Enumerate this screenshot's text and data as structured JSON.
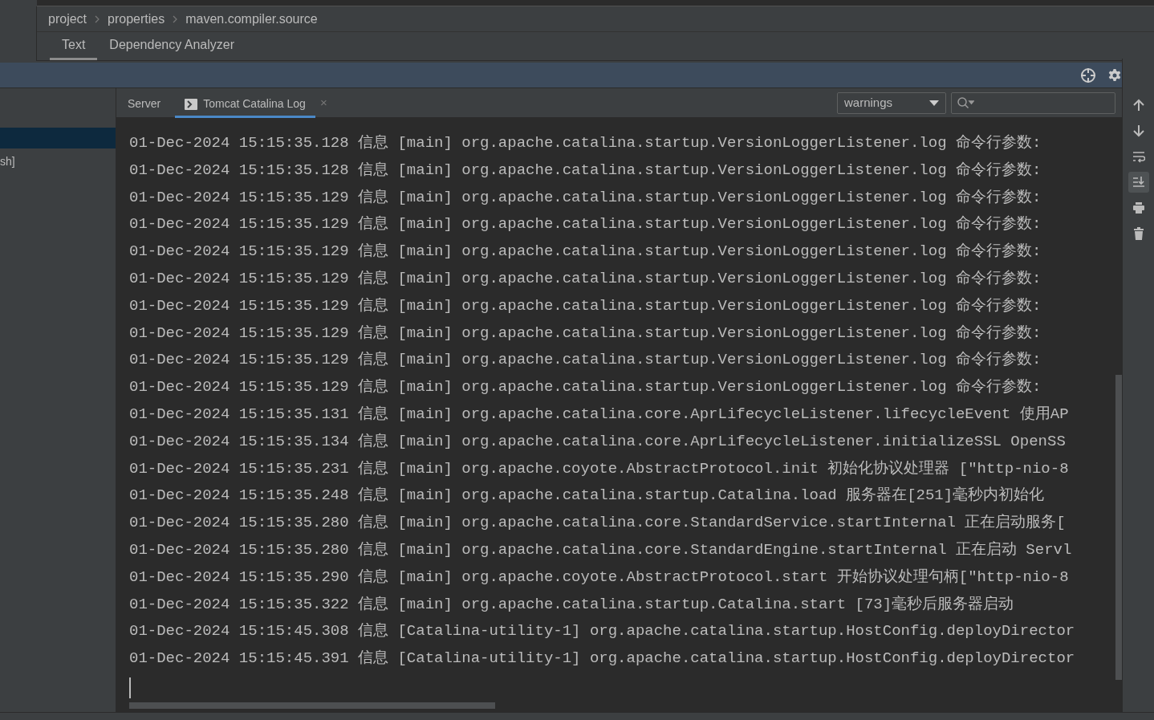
{
  "breadcrumb": [
    "project",
    "properties",
    "maven.compiler.source"
  ],
  "editor_tabs": [
    {
      "label": "Text",
      "selected": true
    },
    {
      "label": "Dependency Analyzer",
      "selected": false
    }
  ],
  "left_panel": {
    "items": [
      {
        "label": "sh]",
        "selected": false
      }
    ]
  },
  "console_tabs": [
    {
      "label": "Server",
      "selected": false,
      "kind": "plain"
    },
    {
      "label": "Tomcat Catalina Log",
      "selected": true,
      "kind": "log",
      "close": "×"
    }
  ],
  "filter": {
    "value": "warnings"
  },
  "log_lines": [
    "01-Dec-2024 15:15:35.128 信息 [main] org.apache.catalina.startup.VersionLoggerListener.log 命令行参数:",
    "01-Dec-2024 15:15:35.128 信息 [main] org.apache.catalina.startup.VersionLoggerListener.log 命令行参数:",
    "01-Dec-2024 15:15:35.129 信息 [main] org.apache.catalina.startup.VersionLoggerListener.log 命令行参数:",
    "01-Dec-2024 15:15:35.129 信息 [main] org.apache.catalina.startup.VersionLoggerListener.log 命令行参数:",
    "01-Dec-2024 15:15:35.129 信息 [main] org.apache.catalina.startup.VersionLoggerListener.log 命令行参数:",
    "01-Dec-2024 15:15:35.129 信息 [main] org.apache.catalina.startup.VersionLoggerListener.log 命令行参数:",
    "01-Dec-2024 15:15:35.129 信息 [main] org.apache.catalina.startup.VersionLoggerListener.log 命令行参数:",
    "01-Dec-2024 15:15:35.129 信息 [main] org.apache.catalina.startup.VersionLoggerListener.log 命令行参数:",
    "01-Dec-2024 15:15:35.129 信息 [main] org.apache.catalina.startup.VersionLoggerListener.log 命令行参数:",
    "01-Dec-2024 15:15:35.129 信息 [main] org.apache.catalina.startup.VersionLoggerListener.log 命令行参数:",
    "01-Dec-2024 15:15:35.131 信息 [main] org.apache.catalina.core.AprLifecycleListener.lifecycleEvent 使用AP",
    "01-Dec-2024 15:15:35.134 信息 [main] org.apache.catalina.core.AprLifecycleListener.initializeSSL OpenSS",
    "01-Dec-2024 15:15:35.231 信息 [main] org.apache.coyote.AbstractProtocol.init 初始化协议处理器 [\"http-nio-8",
    "01-Dec-2024 15:15:35.248 信息 [main] org.apache.catalina.startup.Catalina.load 服务器在[251]毫秒内初始化",
    "01-Dec-2024 15:15:35.280 信息 [main] org.apache.catalina.core.StandardService.startInternal 正在启动服务[",
    "01-Dec-2024 15:15:35.280 信息 [main] org.apache.catalina.core.StandardEngine.startInternal 正在启动 Servl",
    "01-Dec-2024 15:15:35.290 信息 [main] org.apache.coyote.AbstractProtocol.start 开始协议处理句柄[\"http-nio-8",
    "01-Dec-2024 15:15:35.322 信息 [main] org.apache.catalina.startup.Catalina.start [73]毫秒后服务器启动",
    "01-Dec-2024 15:15:45.308 信息 [Catalina-utility-1] org.apache.catalina.startup.HostConfig.deployDirector",
    "01-Dec-2024 15:15:45.391 信息 [Catalina-utility-1] org.apache.catalina.startup.HostConfig.deployDirector"
  ],
  "side_tools": [
    {
      "kind": "up",
      "on": false
    },
    {
      "kind": "down",
      "on": false
    },
    {
      "kind": "wrap",
      "on": false
    },
    {
      "kind": "scroll-end",
      "on": true
    },
    {
      "kind": "print",
      "on": false
    },
    {
      "kind": "trash",
      "on": false
    }
  ]
}
